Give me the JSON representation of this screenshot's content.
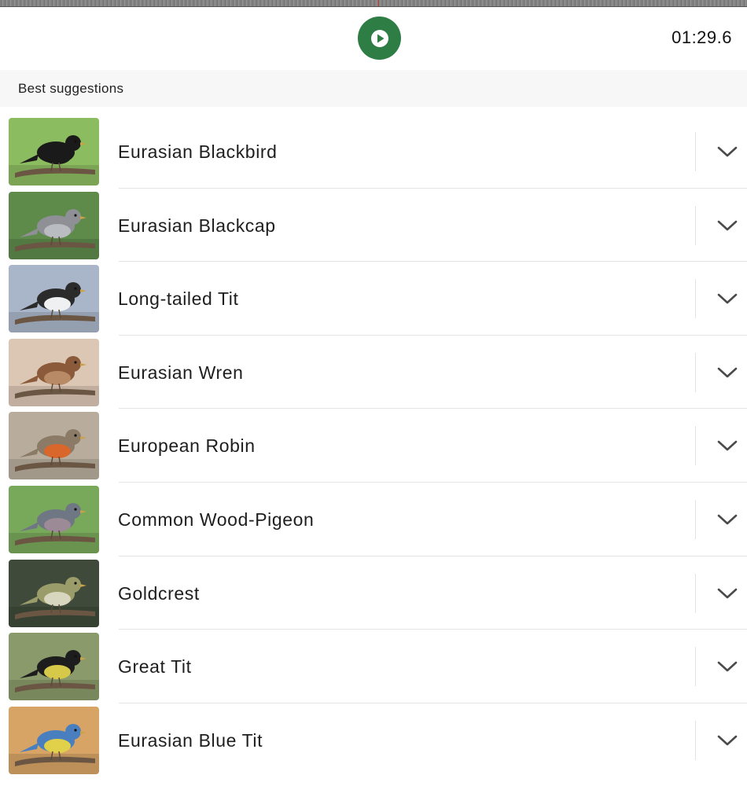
{
  "player": {
    "play_icon": "play-icon",
    "accent_color": "#2e7d45",
    "elapsed_time": "01:29.6"
  },
  "section": {
    "title": "Best suggestions"
  },
  "suggestions": [
    {
      "name": "Eurasian Blackbird",
      "bird_color": "#1a1a1a",
      "belly_color": "#1a1a1a",
      "bg": "#8cbc60",
      "expand_icon": "chevron-down-icon"
    },
    {
      "name": "Eurasian Blackcap",
      "bird_color": "#8e9096",
      "belly_color": "#b9bcc0",
      "bg": "#5e8a4a",
      "expand_icon": "chevron-down-icon"
    },
    {
      "name": "Long-tailed Tit",
      "bird_color": "#2b2b2b",
      "belly_color": "#eef0f2",
      "bg": "#a9b6c9",
      "expand_icon": "chevron-down-icon"
    },
    {
      "name": "Eurasian Wren",
      "bird_color": "#8a5a3a",
      "belly_color": "#b98a66",
      "bg": "#dcc6b4",
      "expand_icon": "chevron-down-icon"
    },
    {
      "name": "European Robin",
      "bird_color": "#8a7a66",
      "belly_color": "#d9662a",
      "bg": "#b8ad9d",
      "expand_icon": "chevron-down-icon"
    },
    {
      "name": "Common Wood-Pigeon",
      "bird_color": "#6f7784",
      "belly_color": "#9c8a96",
      "bg": "#78a85a",
      "expand_icon": "chevron-down-icon"
    },
    {
      "name": "Goldcrest",
      "bird_color": "#9a9c6a",
      "belly_color": "#d9d6c0",
      "bg": "#3f4a3a",
      "expand_icon": "chevron-down-icon"
    },
    {
      "name": "Great Tit",
      "bird_color": "#1d1d1d",
      "belly_color": "#d6c94a",
      "bg": "#8a9a6a",
      "expand_icon": "chevron-down-icon"
    },
    {
      "name": "Eurasian Blue Tit",
      "bird_color": "#4a7fbf",
      "belly_color": "#e0d04a",
      "bg": "#d8a466",
      "expand_icon": "chevron-down-icon"
    }
  ]
}
